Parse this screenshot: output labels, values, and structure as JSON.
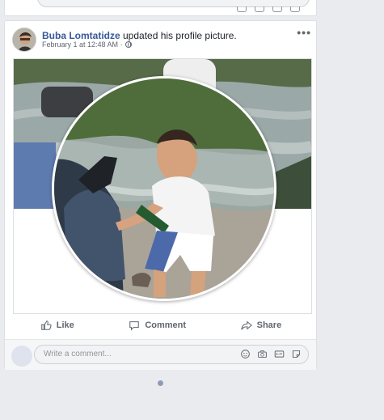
{
  "post": {
    "author": "Buba Lomtatidze",
    "action_text": " updated his profile picture.",
    "timestamp": "February 1 at 12:48 AM",
    "separator": "·"
  },
  "actions": {
    "like": "Like",
    "comment": "Comment",
    "share": "Share"
  },
  "comment_input": {
    "placeholder": "Write a comment..."
  },
  "icons": {
    "privacy": "globe-icon",
    "options": "more-options-icon",
    "like": "thumbs-up-icon",
    "comment": "speech-bubble-icon",
    "share": "share-arrow-icon",
    "emoji": "smiley-icon",
    "camera": "camera-icon",
    "gif": "gif-icon",
    "sticker": "sticker-icon"
  },
  "colors": {
    "author_link": "#365899",
    "background": "#e9ebee",
    "action_text": "#606770"
  }
}
